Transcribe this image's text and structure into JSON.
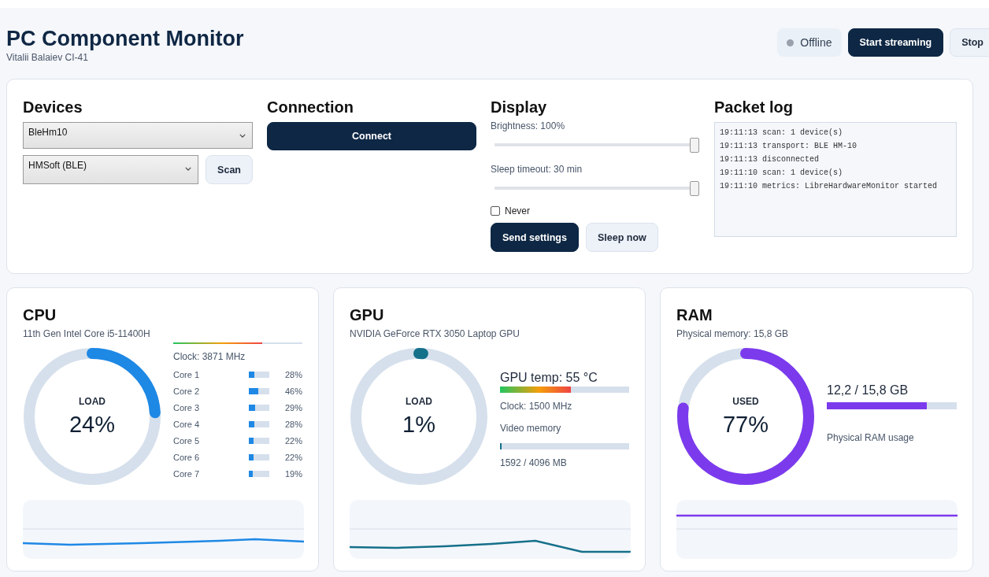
{
  "header": {
    "title": "PC Component Monitor",
    "subtitle": "Vitalii Balaiev CI-41",
    "status": {
      "label": "Offline",
      "online": false
    },
    "buttons": [
      {
        "label": "Start streaming",
        "kind": "primary"
      },
      {
        "label": "Stop",
        "kind": "secondary"
      }
    ]
  },
  "devices": {
    "title": "Devices",
    "transport": "BleHm10",
    "device": "HMSoft (BLE)",
    "scan_button": "Scan"
  },
  "connection": {
    "title": "Connection",
    "button": "Connect"
  },
  "display": {
    "title": "Display",
    "sliders": [
      {
        "label": "Brightness: 100%",
        "level": 1
      },
      {
        "label": "Sleep timeout: 30 min",
        "level": 1
      }
    ],
    "never": {
      "label": "Never",
      "checked": false
    },
    "buttons": [
      {
        "label": "Send settings",
        "kind": "primary"
      },
      {
        "label": "Sleep now",
        "kind": "secondary"
      }
    ]
  },
  "packet_log": {
    "title": "Packet log",
    "lines": [
      "19:11:13 scan: 1 device(s)",
      "19:11:13 transport: BLE HM-10",
      "19:11:13 disconnected",
      "19:11:10 scan: 1 device(s)",
      "19:11:10 metrics: LibreHardwareMonitor started"
    ]
  },
  "cards": [
    {
      "kind": "cpu",
      "title": "CPU",
      "subtitle": "11th Gen Intel Core i5-11400H",
      "color": "#1e88e5",
      "gauge": {
        "label": "LOAD",
        "value": "24%",
        "level": 0.24
      },
      "temp": {
        "level": 0.69
      },
      "clock": "Clock: 3871 MHz",
      "cores": [
        {
          "name": "Core 1",
          "value": "28%",
          "level": 0.28
        },
        {
          "name": "Core 2",
          "value": "46%",
          "level": 0.46
        },
        {
          "name": "Core 3",
          "value": "29%",
          "level": 0.29
        },
        {
          "name": "Core 4",
          "value": "28%",
          "level": 0.28
        },
        {
          "name": "Core 5",
          "value": "22%",
          "level": 0.22
        },
        {
          "name": "Core 6",
          "value": "22%",
          "level": 0.22
        },
        {
          "name": "Core 7",
          "value": "19%",
          "level": 0.19
        }
      ]
    },
    {
      "kind": "gpu",
      "title": "GPU",
      "subtitle": "NVIDIA GeForce RTX 3050 Laptop GPU",
      "color": "#15708a",
      "gauge": {
        "label": "LOAD",
        "value": "1%",
        "level": 0.01
      },
      "temp": {
        "label": "GPU temp: 55 °C",
        "level": 0.55
      },
      "clock": "Clock: 1500 MHz",
      "memory": {
        "label": "Video memory",
        "level": 0.01,
        "reading": "1592 / 4096 MB"
      }
    },
    {
      "kind": "ram",
      "title": "RAM",
      "subtitle": "Physical memory: 15,8 GB",
      "color": "#7c3aed",
      "gauge": {
        "label": "USED",
        "value": "77%",
        "level": 0.77
      },
      "usage": {
        "reading": "12,2 / 15,8 GB",
        "level": 0.77,
        "caption": "Physical RAM usage"
      }
    }
  ]
}
